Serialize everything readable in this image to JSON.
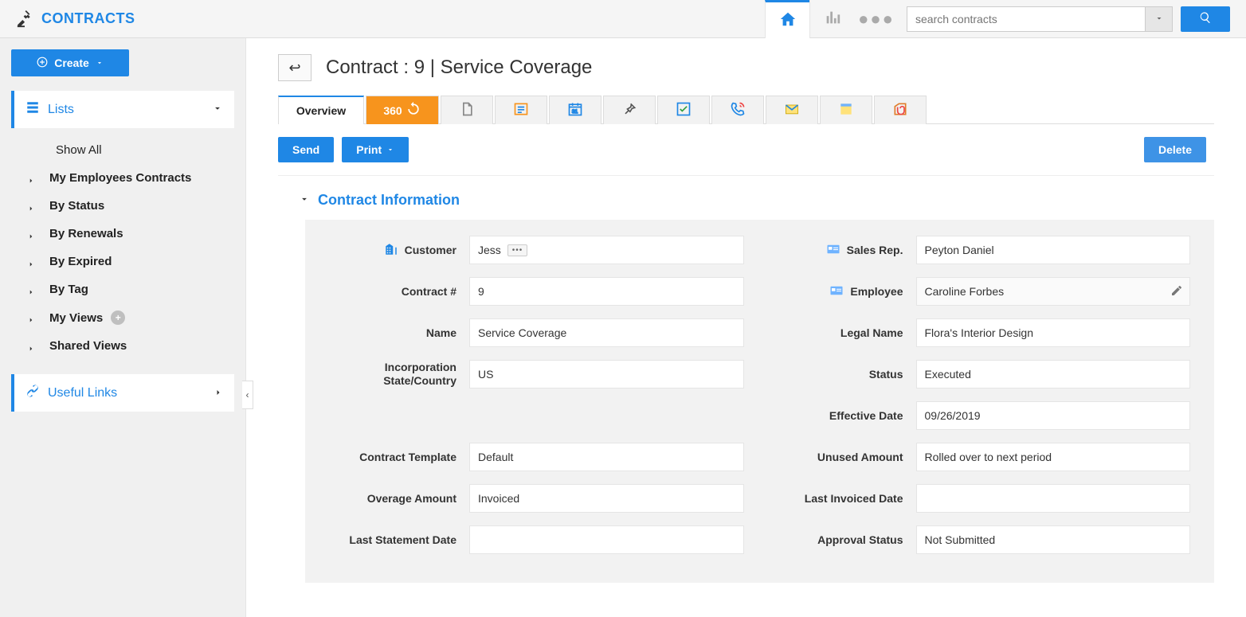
{
  "brand": "CONTRACTS",
  "search_placeholder": "search contracts",
  "sidebar": {
    "create_label": "Create",
    "lists_label": "Lists",
    "show_all": "Show All",
    "items": [
      "My Employees Contracts",
      "By Status",
      "By Renewals",
      "By Expired",
      "By Tag",
      "My Views",
      "Shared Views"
    ],
    "useful_links": "Useful Links"
  },
  "page": {
    "title": "Contract : 9 | Service Coverage",
    "overview_tab": "Overview",
    "tab360": "360",
    "send": "Send",
    "print": "Print",
    "delete": "Delete",
    "section_title": "Contract Information"
  },
  "form": {
    "left": {
      "customer_label": "Customer",
      "customer_value": "Jess",
      "contractnum_label": "Contract #",
      "contractnum_value": "9",
      "name_label": "Name",
      "name_value": "Service Coverage",
      "incorp_label": "Incorporation State/Country",
      "incorp_value": "US",
      "template_label": "Contract Template",
      "template_value": "Default",
      "overage_label": "Overage Amount",
      "overage_value": "Invoiced",
      "laststmt_label": "Last Statement Date",
      "laststmt_value": ""
    },
    "right": {
      "salesrep_label": "Sales Rep.",
      "salesrep_value": "Peyton Daniel",
      "employee_label": "Employee",
      "employee_value": "Caroline Forbes",
      "legal_label": "Legal Name",
      "legal_value": "Flora's Interior Design",
      "status_label": "Status",
      "status_value": "Executed",
      "effdate_label": "Effective Date",
      "effdate_value": "09/26/2019",
      "unused_label": "Unused Amount",
      "unused_value": "Rolled over to next period",
      "lastinv_label": "Last Invoiced Date",
      "lastinv_value": "",
      "approval_label": "Approval Status",
      "approval_value": "Not Submitted"
    }
  }
}
